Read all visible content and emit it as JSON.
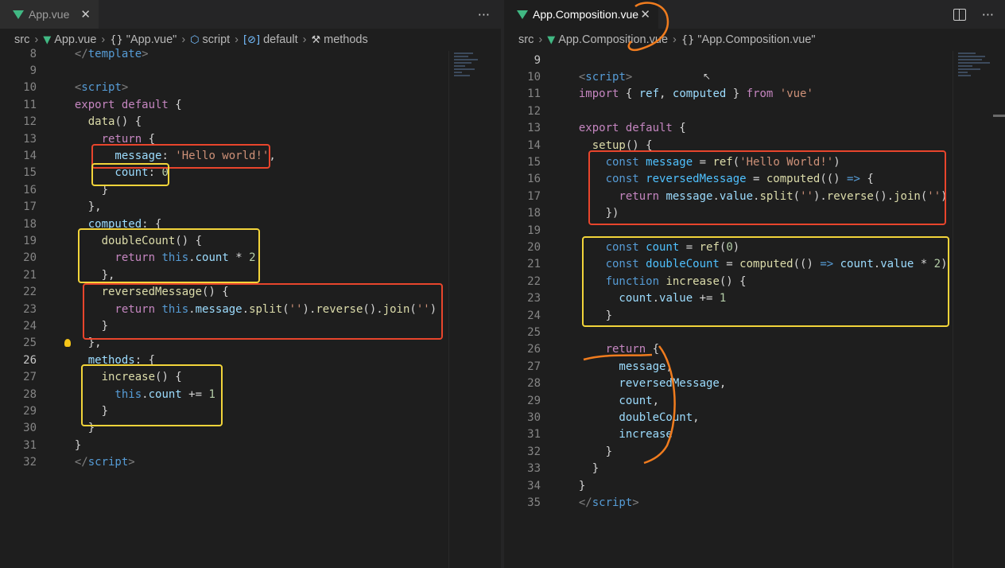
{
  "left_pane": {
    "tab": {
      "title": "App.vue",
      "close": "✕",
      "more": "···"
    },
    "breadcrumb": [
      {
        "icon": "",
        "label": "src"
      },
      {
        "icon": "V",
        "label": "App.vue"
      },
      {
        "icon": "{}",
        "label": "\"App.vue\""
      },
      {
        "icon": "⬡",
        "label": "script"
      },
      {
        "icon": "[⊘]",
        "label": "default"
      },
      {
        "icon": "⚒",
        "label": "methods"
      }
    ],
    "lines": [
      {
        "n": "8",
        "t": [
          [
            "br",
            "  </"
          ],
          [
            "tag",
            "template"
          ],
          [
            "br",
            ">"
          ]
        ]
      },
      {
        "n": "9",
        "t": []
      },
      {
        "n": "10",
        "t": [
          [
            "br",
            "  <"
          ],
          [
            "tag",
            "script"
          ],
          [
            "br",
            ">"
          ]
        ]
      },
      {
        "n": "11",
        "t": [
          [
            "kw2",
            "  export default"
          ],
          [
            "code",
            " {"
          ]
        ]
      },
      {
        "n": "12",
        "t": [
          [
            "fn",
            "    data"
          ],
          [
            "code",
            "() {"
          ]
        ]
      },
      {
        "n": "13",
        "t": [
          [
            "kw2",
            "      return"
          ],
          [
            "code",
            " {"
          ]
        ]
      },
      {
        "n": "14",
        "t": [
          [
            "var",
            "        message"
          ],
          [
            "code",
            ": "
          ],
          [
            "str",
            "'Hello world!'"
          ],
          [
            "code",
            ","
          ]
        ]
      },
      {
        "n": "15",
        "t": [
          [
            "var",
            "        count"
          ],
          [
            "code",
            ": "
          ],
          [
            "num",
            "0"
          ]
        ]
      },
      {
        "n": "16",
        "t": [
          [
            "code",
            "      }"
          ]
        ]
      },
      {
        "n": "17",
        "t": [
          [
            "code",
            "    },"
          ]
        ]
      },
      {
        "n": "18",
        "t": [
          [
            "var",
            "    computed"
          ],
          [
            "code",
            ": {"
          ]
        ]
      },
      {
        "n": "19",
        "t": [
          [
            "fn",
            "      doubleCount"
          ],
          [
            "code",
            "() {"
          ]
        ]
      },
      {
        "n": "20",
        "t": [
          [
            "kw2",
            "        return"
          ],
          [
            "kw",
            " this"
          ],
          [
            "code",
            "."
          ],
          [
            "var",
            "count"
          ],
          [
            "code",
            " * "
          ],
          [
            "num",
            "2"
          ]
        ]
      },
      {
        "n": "21",
        "t": [
          [
            "code",
            "      },"
          ]
        ]
      },
      {
        "n": "22",
        "t": [
          [
            "fn",
            "      reversedMessage"
          ],
          [
            "code",
            "() {"
          ]
        ]
      },
      {
        "n": "23",
        "t": [
          [
            "kw2",
            "        return"
          ],
          [
            "kw",
            " this"
          ],
          [
            "code",
            "."
          ],
          [
            "var",
            "message"
          ],
          [
            "code",
            "."
          ],
          [
            "fn",
            "split"
          ],
          [
            "code",
            "("
          ],
          [
            "str",
            "''"
          ],
          [
            "code",
            ")."
          ],
          [
            "fn",
            "reverse"
          ],
          [
            "code",
            "()."
          ],
          [
            "fn",
            "join"
          ],
          [
            "code",
            "("
          ],
          [
            "str",
            "''"
          ],
          [
            "code",
            ")"
          ]
        ]
      },
      {
        "n": "24",
        "t": [
          [
            "code",
            "      }"
          ]
        ]
      },
      {
        "n": "25",
        "t": [
          [
            "code",
            "    },"
          ]
        ]
      },
      {
        "n": "26",
        "t": [
          [
            "var",
            "    methods"
          ],
          [
            "code",
            ": {"
          ]
        ]
      },
      {
        "n": "27",
        "t": [
          [
            "fn",
            "      increase"
          ],
          [
            "code",
            "() {"
          ]
        ]
      },
      {
        "n": "28",
        "t": [
          [
            "kw",
            "        this"
          ],
          [
            "code",
            "."
          ],
          [
            "var",
            "count"
          ],
          [
            "code",
            " += "
          ],
          [
            "num",
            "1"
          ]
        ]
      },
      {
        "n": "29",
        "t": [
          [
            "code",
            "      }"
          ]
        ]
      },
      {
        "n": "30",
        "t": [
          [
            "code",
            "    }"
          ]
        ]
      },
      {
        "n": "31",
        "t": [
          [
            "code",
            "  }"
          ]
        ]
      },
      {
        "n": "32",
        "t": [
          [
            "br",
            "  </"
          ],
          [
            "tag",
            "script"
          ],
          [
            "br",
            ">"
          ]
        ]
      }
    ]
  },
  "right_pane": {
    "tab": {
      "title": "App.Composition.vue",
      "close": "✕",
      "more": "···"
    },
    "breadcrumb": [
      {
        "icon": "",
        "label": "src"
      },
      {
        "icon": "V",
        "label": "App.Composition.vue"
      },
      {
        "icon": "{}",
        "label": "\"App.Composition.vue\""
      }
    ],
    "lines": [
      {
        "n": "9",
        "t": []
      },
      {
        "n": "10",
        "t": [
          [
            "br",
            "  <"
          ],
          [
            "tag",
            "script"
          ],
          [
            "br",
            ">"
          ]
        ]
      },
      {
        "n": "11",
        "t": [
          [
            "kw2",
            "  import"
          ],
          [
            "code",
            " { "
          ],
          [
            "var",
            "ref"
          ],
          [
            "code",
            ", "
          ],
          [
            "var",
            "computed"
          ],
          [
            "code",
            " } "
          ],
          [
            "kw2",
            "from"
          ],
          [
            "str",
            " 'vue'"
          ]
        ]
      },
      {
        "n": "12",
        "t": []
      },
      {
        "n": "13",
        "t": [
          [
            "kw2",
            "  export default"
          ],
          [
            "code",
            " {"
          ]
        ]
      },
      {
        "n": "14",
        "t": [
          [
            "fn",
            "    setup"
          ],
          [
            "code",
            "() {"
          ]
        ]
      },
      {
        "n": "15",
        "t": [
          [
            "kw",
            "      const"
          ],
          [
            "const",
            " message"
          ],
          [
            "code",
            " = "
          ],
          [
            "fn",
            "ref"
          ],
          [
            "code",
            "("
          ],
          [
            "str",
            "'Hello World!'"
          ],
          [
            "code",
            ")"
          ]
        ]
      },
      {
        "n": "16",
        "t": [
          [
            "kw",
            "      const"
          ],
          [
            "const",
            " reversedMessage"
          ],
          [
            "code",
            " = "
          ],
          [
            "fn",
            "computed"
          ],
          [
            "code",
            "(() "
          ],
          [
            "kw",
            "=>"
          ],
          [
            "code",
            " {"
          ]
        ]
      },
      {
        "n": "17",
        "t": [
          [
            "kw2",
            "        return"
          ],
          [
            "var",
            " message"
          ],
          [
            "code",
            "."
          ],
          [
            "var",
            "value"
          ],
          [
            "code",
            "."
          ],
          [
            "fn",
            "split"
          ],
          [
            "code",
            "("
          ],
          [
            "str",
            "''"
          ],
          [
            "code",
            ")."
          ],
          [
            "fn",
            "reverse"
          ],
          [
            "code",
            "()."
          ],
          [
            "fn",
            "join"
          ],
          [
            "code",
            "("
          ],
          [
            "str",
            "''"
          ],
          [
            "code",
            ")"
          ]
        ]
      },
      {
        "n": "18",
        "t": [
          [
            "code",
            "      })"
          ]
        ]
      },
      {
        "n": "19",
        "t": []
      },
      {
        "n": "20",
        "t": [
          [
            "kw",
            "      const"
          ],
          [
            "const",
            " count"
          ],
          [
            "code",
            " = "
          ],
          [
            "fn",
            "ref"
          ],
          [
            "code",
            "("
          ],
          [
            "num",
            "0"
          ],
          [
            "code",
            ")"
          ]
        ]
      },
      {
        "n": "21",
        "t": [
          [
            "kw",
            "      const"
          ],
          [
            "const",
            " doubleCount"
          ],
          [
            "code",
            " = "
          ],
          [
            "fn",
            "computed"
          ],
          [
            "code",
            "(() "
          ],
          [
            "kw",
            "=>"
          ],
          [
            "var",
            " count"
          ],
          [
            "code",
            "."
          ],
          [
            "var",
            "value"
          ],
          [
            "code",
            " * "
          ],
          [
            "num",
            "2"
          ],
          [
            "code",
            ")"
          ]
        ]
      },
      {
        "n": "22",
        "t": [
          [
            "kw",
            "      function"
          ],
          [
            "fn",
            " increase"
          ],
          [
            "code",
            "() {"
          ]
        ]
      },
      {
        "n": "23",
        "t": [
          [
            "var",
            "        count"
          ],
          [
            "code",
            "."
          ],
          [
            "var",
            "value"
          ],
          [
            "code",
            " += "
          ],
          [
            "num",
            "1"
          ]
        ]
      },
      {
        "n": "24",
        "t": [
          [
            "code",
            "      }"
          ]
        ]
      },
      {
        "n": "25",
        "t": []
      },
      {
        "n": "26",
        "t": [
          [
            "kw2",
            "      return"
          ],
          [
            "code",
            " {"
          ]
        ]
      },
      {
        "n": "27",
        "t": [
          [
            "var",
            "        message"
          ],
          [
            "code",
            ","
          ]
        ]
      },
      {
        "n": "28",
        "t": [
          [
            "var",
            "        reversedMessage"
          ],
          [
            "code",
            ","
          ]
        ]
      },
      {
        "n": "29",
        "t": [
          [
            "var",
            "        count"
          ],
          [
            "code",
            ","
          ]
        ]
      },
      {
        "n": "30",
        "t": [
          [
            "var",
            "        doubleCount"
          ],
          [
            "code",
            ","
          ]
        ]
      },
      {
        "n": "31",
        "t": [
          [
            "var",
            "        increase"
          ]
        ]
      },
      {
        "n": "32",
        "t": [
          [
            "code",
            "      }"
          ]
        ]
      },
      {
        "n": "33",
        "t": [
          [
            "code",
            "    }"
          ]
        ]
      },
      {
        "n": "34",
        "t": [
          [
            "code",
            "  }"
          ]
        ]
      },
      {
        "n": "35",
        "t": [
          [
            "br",
            "  </"
          ],
          [
            "tag",
            "script"
          ],
          [
            "br",
            ">"
          ]
        ]
      }
    ]
  },
  "colors": {
    "red_box": "#e8452c",
    "yellow_box": "#f2d43a",
    "orange_annotation": "#f07c1e",
    "vue_green": "#41b883"
  }
}
